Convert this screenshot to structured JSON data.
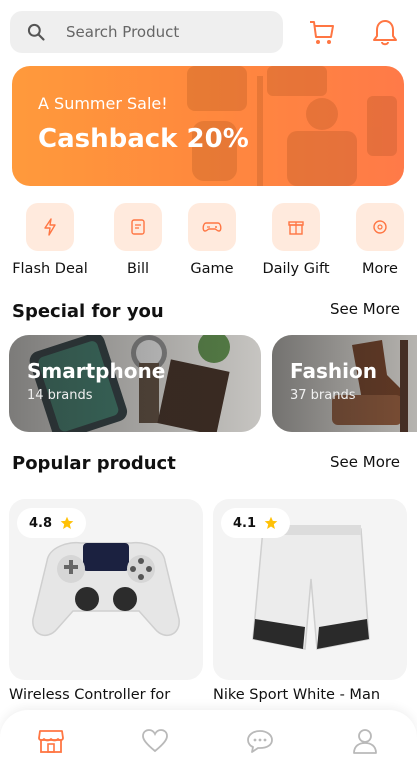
{
  "search": {
    "placeholder": "Search Product",
    "icon": "search-icon"
  },
  "header": {
    "cart_icon": "cart-icon",
    "bell_icon": "bell-icon",
    "accent": "#ff7643"
  },
  "banner": {
    "subtitle": "A Summer Sale!",
    "title": "Cashback 20%"
  },
  "categories": [
    {
      "label": "Flash Deal",
      "icon": "flash-icon"
    },
    {
      "label": "Bill",
      "icon": "bill-icon"
    },
    {
      "label": "Game",
      "icon": "game-icon"
    },
    {
      "label": "Daily Gift",
      "icon": "gift-icon"
    },
    {
      "label": "More",
      "icon": "more-icon"
    }
  ],
  "special": {
    "title": "Special for you",
    "see_more": "See More",
    "cards": [
      {
        "title": "Smartphone",
        "subtitle": "14 brands"
      },
      {
        "title": "Fashion",
        "subtitle": "37 brands"
      }
    ]
  },
  "popular": {
    "title": "Popular product",
    "see_more": "See More",
    "products": [
      {
        "rating": "4.8",
        "name": "Wireless Controller for"
      },
      {
        "rating": "4.1",
        "name": "Nike Sport White - Man"
      }
    ]
  },
  "bottom_nav": {
    "items": [
      "shop-icon",
      "heart-icon",
      "chat-icon",
      "user-icon"
    ],
    "active_color": "#ff7643",
    "inactive_color": "#b9b9b9"
  }
}
